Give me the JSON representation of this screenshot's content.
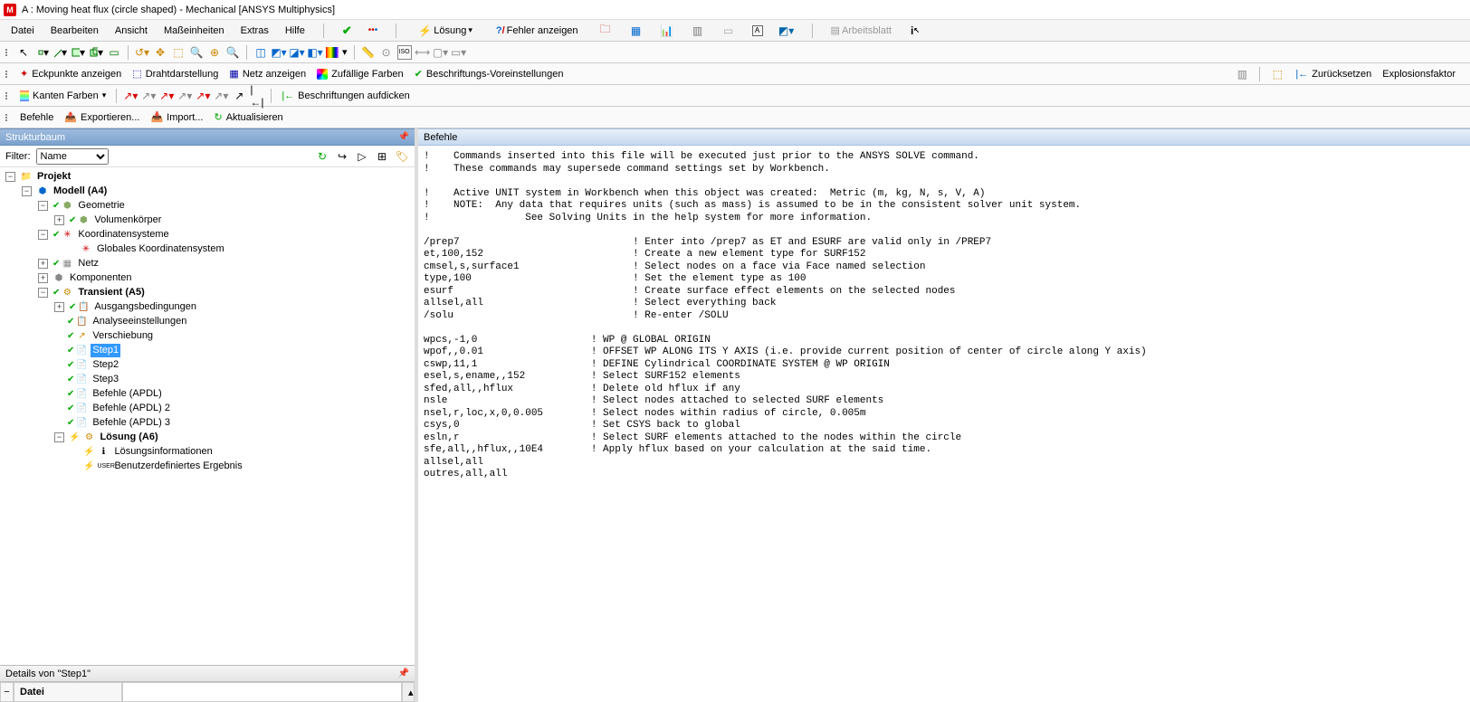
{
  "window": {
    "title": "A : Moving heat flux (circle shaped) - Mechanical [ANSYS Multiphysics]"
  },
  "menu": {
    "datei": "Datei",
    "bearbeiten": "Bearbeiten",
    "ansicht": "Ansicht",
    "masseinheiten": "Maßeinheiten",
    "extras": "Extras",
    "hilfe": "Hilfe",
    "loesung": "Lösung",
    "fehler": "Fehler anzeigen",
    "arbeitsblatt": "Arbeitsblatt"
  },
  "tb3": {
    "eckpunkte": "Eckpunkte anzeigen",
    "draht": "Drahtdarstellung",
    "netz": "Netz anzeigen",
    "farben": "Zufällige Farben",
    "beschr": "Beschriftungs-Voreinstellungen",
    "zurueck": "Zurücksetzen",
    "expl": "Explosionsfaktor"
  },
  "tb4": {
    "kanten": "Kanten Farben",
    "beschrd": "Beschriftungen aufdicken"
  },
  "tb5": {
    "befehle": "Befehle",
    "export": "Exportieren...",
    "import": "Import...",
    "aktual": "Aktualisieren"
  },
  "left": {
    "title": "Strukturbaum",
    "filter": {
      "label": "Filter:",
      "select": "Name"
    },
    "root": "Projekt",
    "model": "Modell (A4)",
    "geo": "Geometrie",
    "volk": "Volumenkörper",
    "koord": "Koordinatensysteme",
    "glob": "Globales Koordinatensystem",
    "netz": "Netz",
    "komp": "Komponenten",
    "trans": "Transient (A5)",
    "ausg": "Ausgangsbedingungen",
    "anal": "Analyseeinstellungen",
    "versch": "Verschiebung",
    "step1": "Step1",
    "step2": "Step2",
    "step3": "Step3",
    "apdl1": "Befehle (APDL)",
    "apdl2": "Befehle (APDL) 2",
    "apdl3": "Befehle (APDL) 3",
    "loes": "Lösung (A6)",
    "loesinfo": "Lösungsinformationen",
    "benutz": "Benutzerdefiniertes Ergebnis",
    "details_title": "Details von \"Step1\"",
    "datei": "Datei"
  },
  "right": {
    "title": "Befehle",
    "code": "!    Commands inserted into this file will be executed just prior to the ANSYS SOLVE command.\n!    These commands may supersede command settings set by Workbench.\n\n!    Active UNIT system in Workbench when this object was created:  Metric (m, kg, N, s, V, A)\n!    NOTE:  Any data that requires units (such as mass) is assumed to be in the consistent solver unit system.\n!                See Solving Units in the help system for more information.\n\n/prep7                             ! Enter into /prep7 as ET and ESURF are valid only in /PREP7\net,100,152                         ! Create a new element type for SURF152\ncmsel,s,surface1                   ! Select nodes on a face via Face named selection\ntype,100                           ! Set the element type as 100\nesurf                              ! Create surface effect elements on the selected nodes\nallsel,all                         ! Select everything back\n/solu                              ! Re-enter /SOLU\n\nwpcs,-1,0                   ! WP @ GLOBAL ORIGIN\nwpof,,0.01                  ! OFFSET WP ALONG ITS Y AXIS (i.e. provide current position of center of circle along Y axis)\ncswp,11,1                   ! DEFINE Cylindrical COORDINATE SYSTEM @ WP ORIGIN\nesel,s,ename,,152           ! Select SURF152 elements\nsfed,all,,hflux             ! Delete old hflux if any\nnsle                        ! Select nodes attached to selected SURF elements\nnsel,r,loc,x,0,0.005        ! Select nodes within radius of circle, 0.005m\ncsys,0                      ! Set CSYS back to global\nesln,r                      ! Select SURF elements attached to the nodes within the circle\nsfe,all,,hflux,,10E4        ! Apply hflux based on your calculation at the said time.\nallsel,all\noutres,all,all"
  }
}
